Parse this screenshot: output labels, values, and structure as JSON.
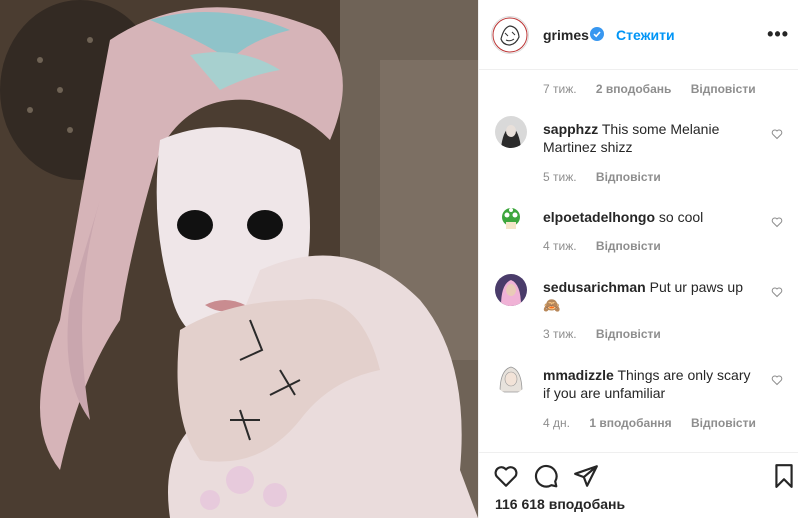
{
  "header": {
    "username": "grimes",
    "follow_label": "Стежити",
    "more_label": "•••"
  },
  "caption_meta": {
    "time": "7 тиж.",
    "likes": "2 вподобань",
    "reply": "Відповісти"
  },
  "comments": [
    {
      "user": "sapphzz",
      "text": "This some Melanie Martinez shizz",
      "time": "5 тиж.",
      "likes": "",
      "reply": "Відповісти"
    },
    {
      "user": "elpoetadelhongo",
      "text": "so cool",
      "time": "4 тиж.",
      "likes": "",
      "reply": "Відповісти"
    },
    {
      "user": "sedusarichman",
      "text": "Put ur paws up 🙈",
      "time": "3 тиж.",
      "likes": "",
      "reply": "Відповісти"
    },
    {
      "user": "mmadizzle",
      "text": "Things are only scary if you are unfamiliar",
      "time": "4 дн.",
      "likes": "1 вподобання",
      "reply": "Відповісти"
    }
  ],
  "footer": {
    "likes_count": "116 618 вподобань"
  },
  "colors": {
    "accent": "#0095f6",
    "text": "#262626",
    "muted": "#8e8e8e",
    "border": "#efefef"
  },
  "icons": [
    "heart-icon",
    "comment-icon",
    "share-icon",
    "bookmark-icon",
    "verified-icon",
    "more-options-icon"
  ]
}
